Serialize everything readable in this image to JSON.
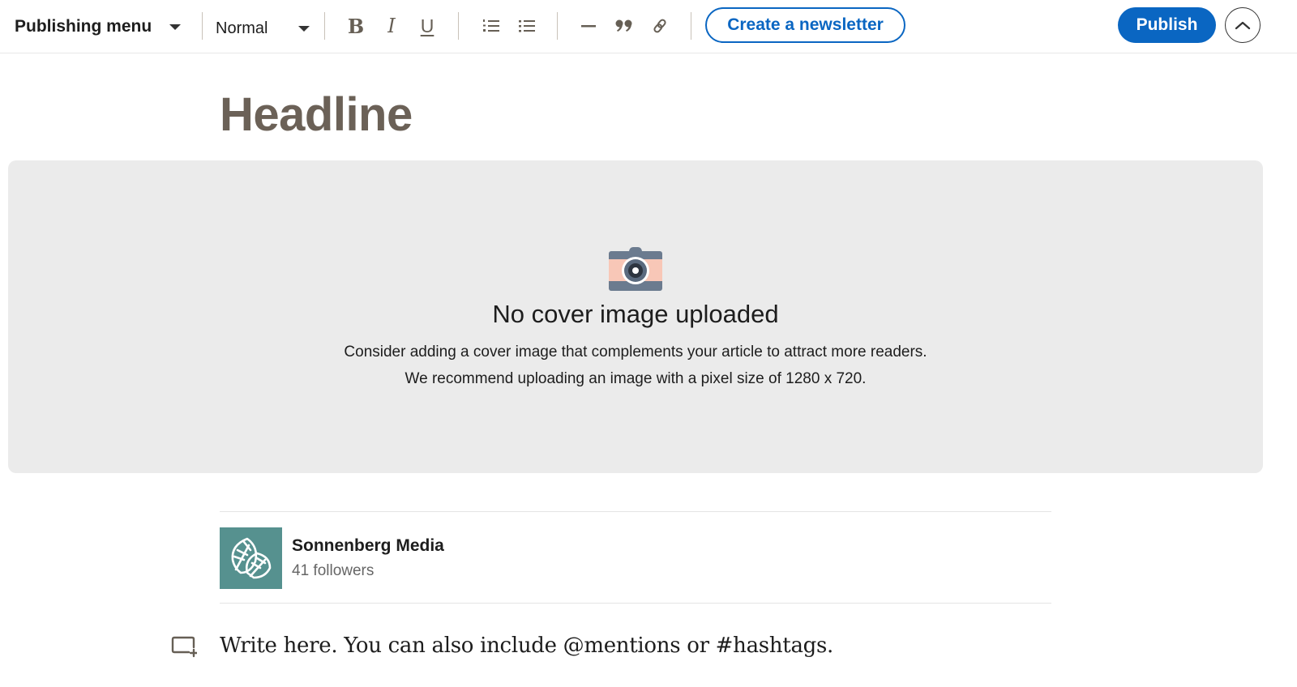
{
  "toolbar": {
    "publishing_menu_label": "Publishing menu",
    "text_style_value": "Normal",
    "bold_label": "B",
    "italic_label": "I",
    "underline_label": "U",
    "create_newsletter_label": "Create a newsletter",
    "publish_label": "Publish",
    "icons": {
      "numbered_list": "numbered-list-icon",
      "bulleted_list": "bulleted-list-icon",
      "divider": "horizontal-rule-icon",
      "quote": "quote-icon",
      "link": "link-icon",
      "collapse": "chevron-up-icon"
    }
  },
  "editor": {
    "headline_placeholder": "Headline",
    "body_placeholder": "Write here. You can also include @mentions or #hashtags."
  },
  "cover": {
    "title": "No cover image uploaded",
    "description_line1": "Consider adding a cover image that complements your article to attract more readers.",
    "description_line2": "We recommend uploading an image with a pixel size of 1280 x 720."
  },
  "author": {
    "name": "Sonnenberg Media",
    "followers": "41 followers"
  },
  "colors": {
    "brand_blue": "#0a66c2",
    "headline_gray": "#6b6157",
    "cover_bg": "#ebebeb",
    "author_logo_bg": "#56918f"
  }
}
